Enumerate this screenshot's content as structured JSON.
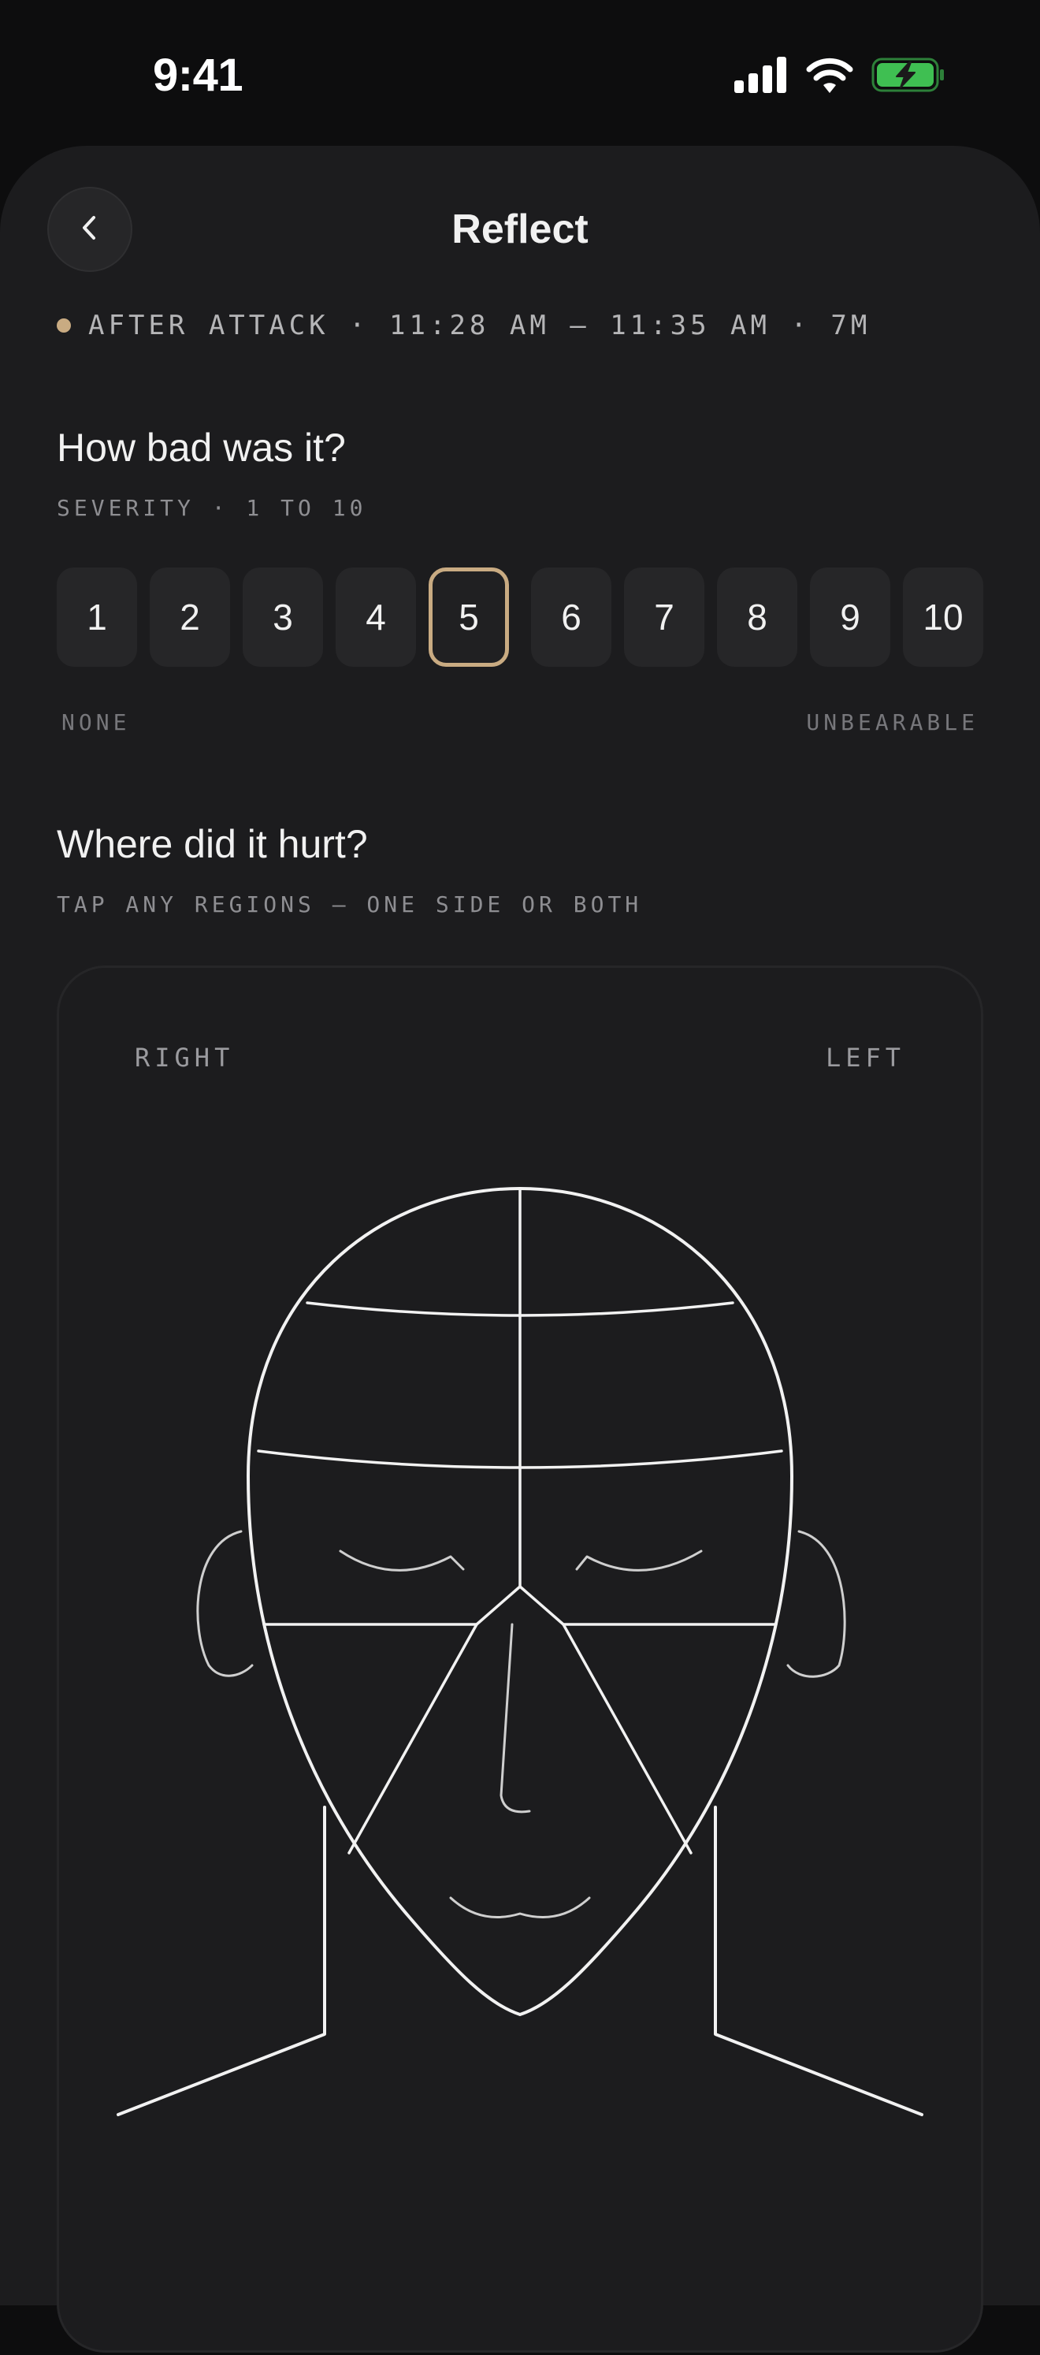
{
  "status_bar": {
    "time": "9:41",
    "icons": [
      "cellular-signal-icon",
      "wifi-icon",
      "battery-charging-icon"
    ],
    "battery_color": "#3fbf52"
  },
  "header": {
    "title": "Reflect",
    "back_icon": "chevron-left-icon"
  },
  "session": {
    "summary": "AFTER ATTACK · 11:28 AM – 11:35 AM · 7M",
    "accent_color": "#c9ab82"
  },
  "severity": {
    "heading": "How bad was it?",
    "subheading": "SEVERITY · 1 TO 10",
    "options": [
      "1",
      "2",
      "3",
      "4",
      "5",
      "6",
      "7",
      "8",
      "9",
      "10"
    ],
    "selected": "5",
    "min_label": "NONE",
    "max_label": "UNBEARABLE"
  },
  "pain_map": {
    "heading": "Where did it hurt?",
    "subheading": "TAP ANY REGIONS — ONE SIDE OR BOTH",
    "right_label": "RIGHT",
    "left_label": "LEFT"
  }
}
